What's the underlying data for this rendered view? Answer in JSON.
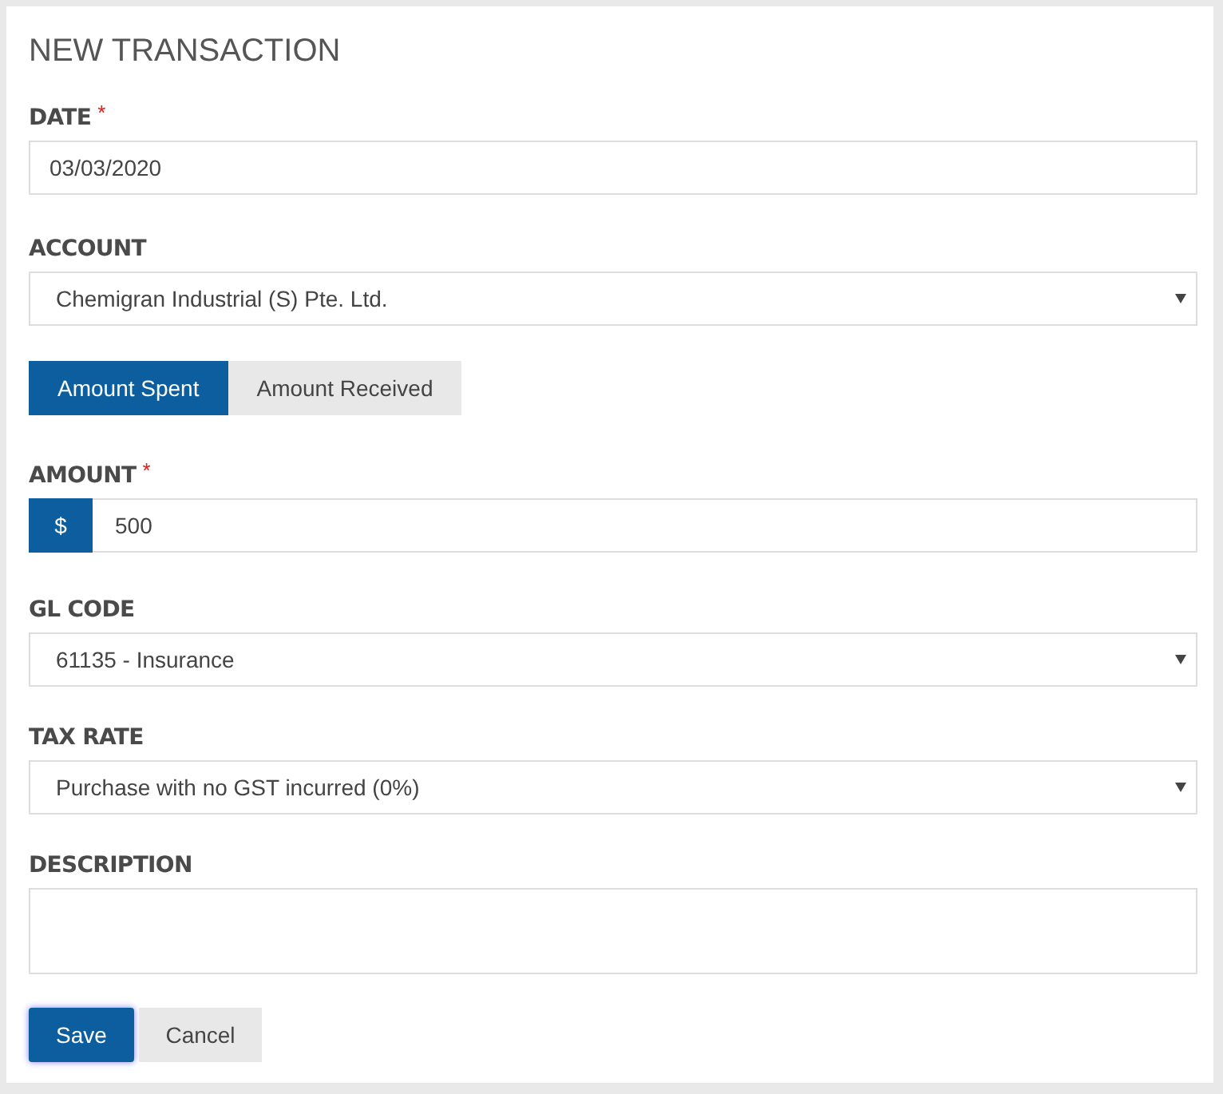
{
  "title": "NEW TRANSACTION",
  "fields": [
    {
      "kind": "text",
      "label": "DATE",
      "required_mark": "*",
      "value": "03/03/2020"
    },
    {
      "kind": "select",
      "label": "ACCOUNT",
      "value": "Chemigran Industrial (S) Pte. Ltd."
    },
    {
      "kind": "toggle",
      "options": [
        {
          "label": "Amount Spent",
          "selected": true
        },
        {
          "label": "Amount Received",
          "selected": false
        }
      ]
    },
    {
      "kind": "amount",
      "label": "AMOUNT",
      "required_mark": "*",
      "prefix": "$",
      "value": "500"
    },
    {
      "kind": "select",
      "label": "GL CODE",
      "value": "61135 - Insurance"
    },
    {
      "kind": "select",
      "label": "TAX RATE",
      "value": "Purchase with no GST incurred (0%)"
    },
    {
      "kind": "textarea",
      "label": "DESCRIPTION"
    }
  ],
  "buttons": [
    {
      "label": "Save",
      "kind": "primary"
    },
    {
      "label": "Cancel",
      "kind": "secondary"
    }
  ]
}
